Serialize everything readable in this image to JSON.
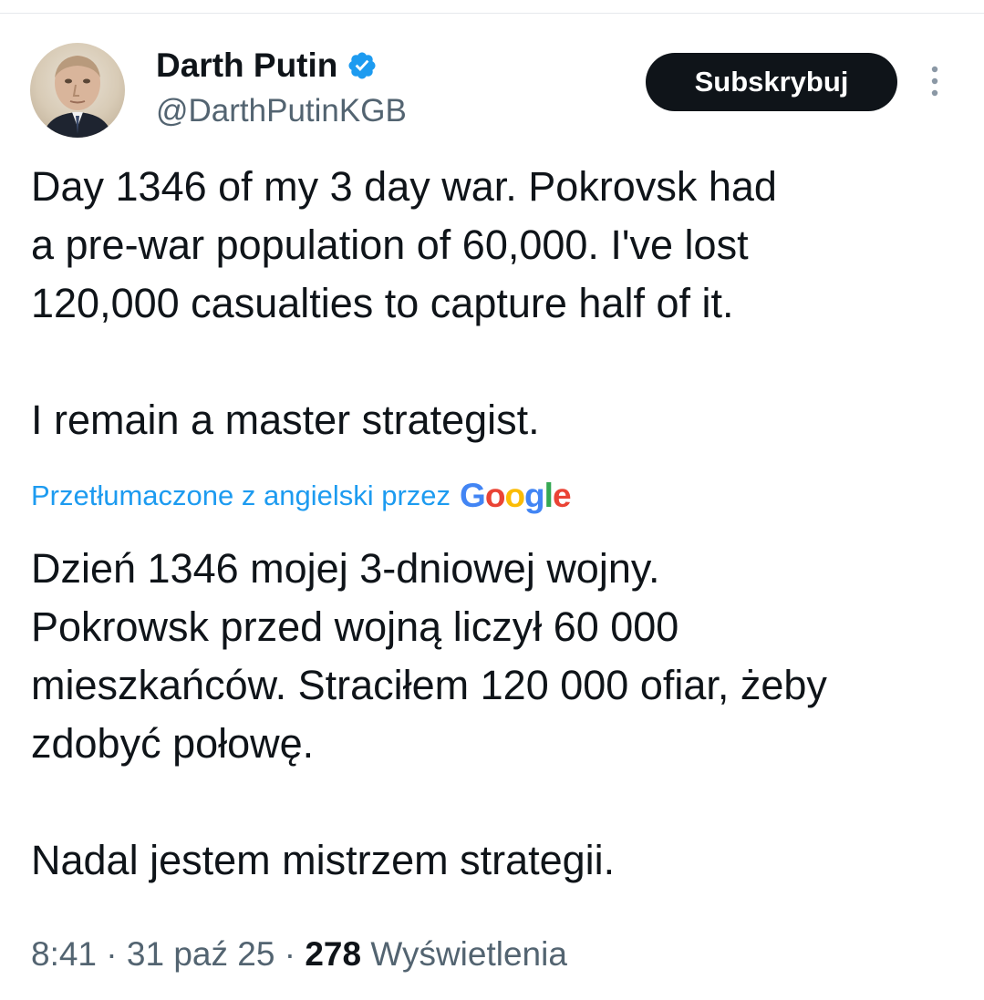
{
  "author": {
    "display_name": "Darth Putin",
    "handle": "@DarthPutinKGB",
    "verified_icon": "verified-badge-icon",
    "accent_color": "#1d9bf0"
  },
  "actions": {
    "subscribe_label": "Subskrybuj",
    "more_icon": "more-vertical-icon"
  },
  "tweet": {
    "original_text": "Day 1346 of my 3 day war. Pokrovsk had\na pre-war population of 60,000. I've lost\n120,000 casualties to capture half of it.\n\nI remain a master strategist.",
    "translation_note": "Przetłumaczone z angielski przez",
    "translation_provider": "Google",
    "translated_text": "Dzień 1346 mojej 3-dniowej wojny.\nPokrowsk przed wojną liczył 60 000\nmieszkańców. Straciłem 120 000 ofiar, żeby\nzdobyć połowę.\n\nNadal jestem mistrzem strategii."
  },
  "meta": {
    "time": "8:41",
    "separator": " · ",
    "date": "31 paź 25",
    "views_count": "278",
    "views_label": "Wyświetlenia"
  }
}
